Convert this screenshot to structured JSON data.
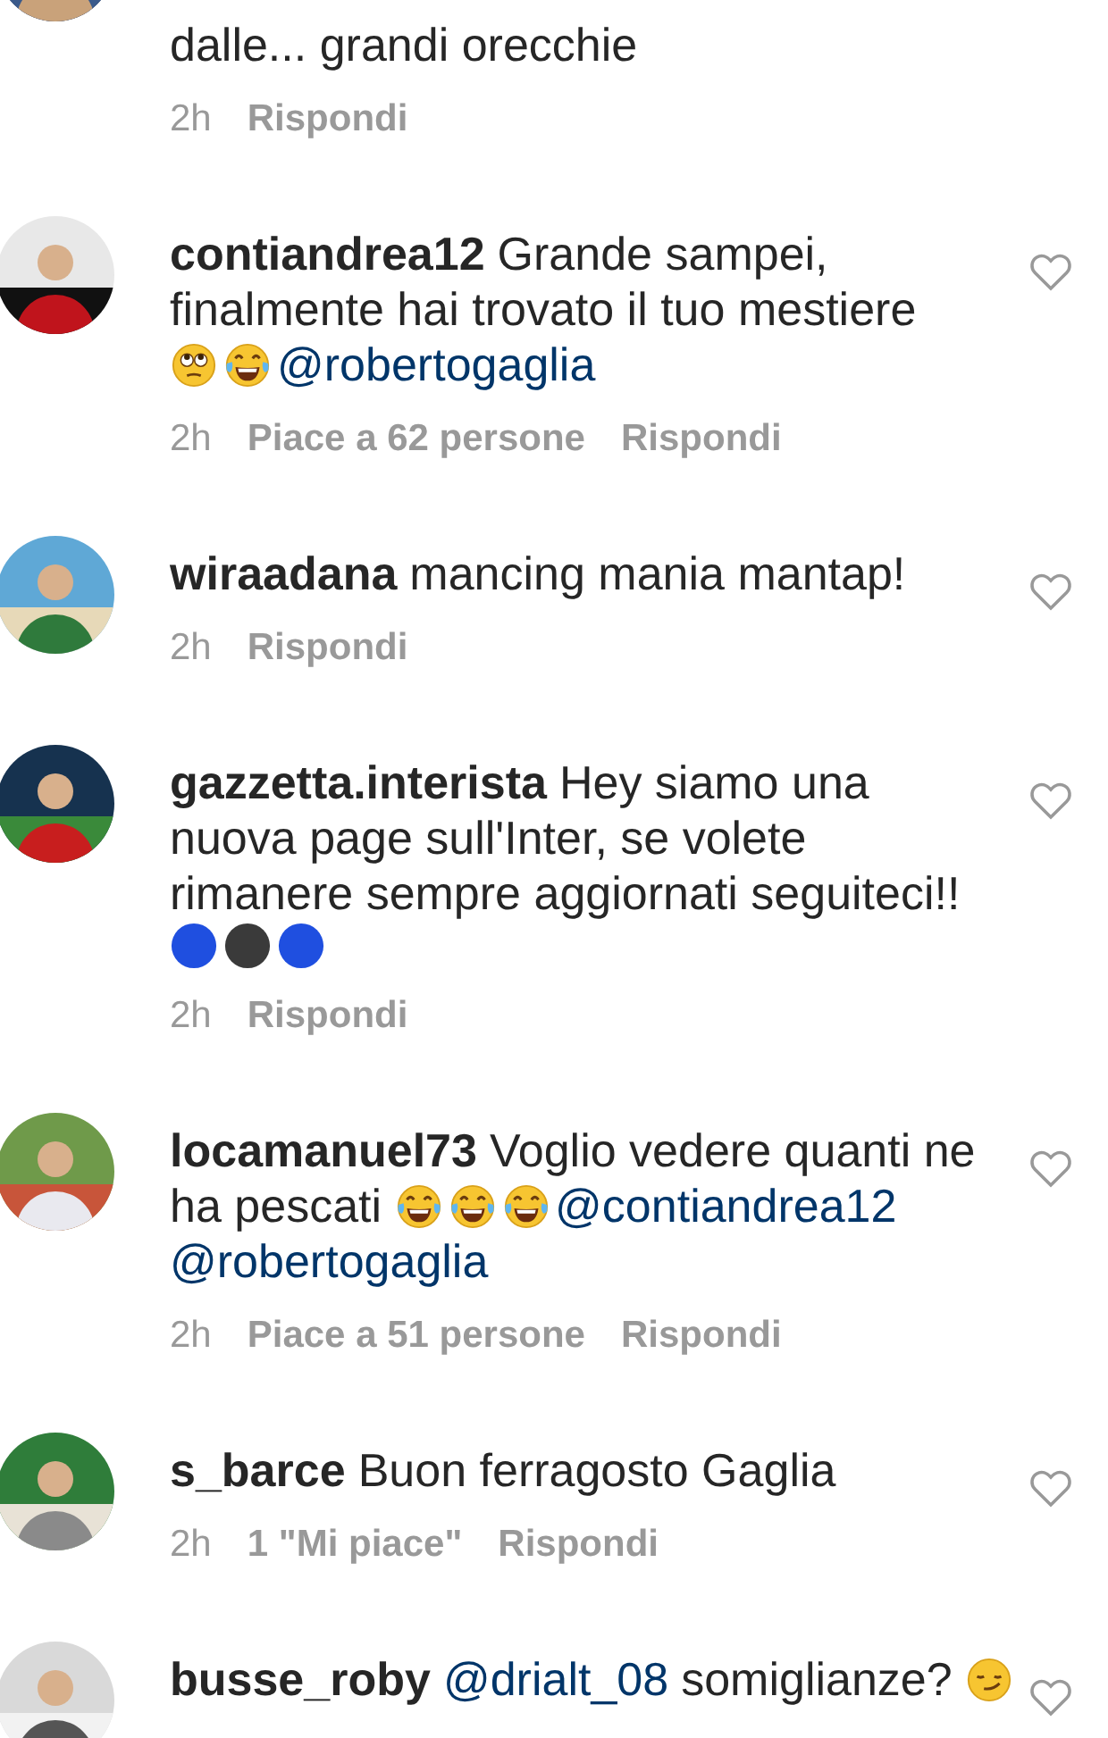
{
  "comments": [
    {
      "lines": [
        [
          {
            "kind": "text",
            "text": "dalle... grandi orecchie"
          }
        ]
      ],
      "time": "2h",
      "reply": "Rispondi"
    },
    {
      "username": "contiandrea12",
      "lines": [
        [
          {
            "kind": "text",
            "text": "Grande sampei,"
          }
        ],
        [
          {
            "kind": "text",
            "text": "finalmente hai trovato il tuo mestiere"
          }
        ],
        [
          {
            "kind": "rolling-eyes"
          },
          {
            "kind": "tears-of-joy"
          },
          {
            "kind": "mention",
            "text": "@robertogaglia"
          }
        ]
      ],
      "liked": false,
      "time": "2h",
      "likes": "Piace a 62 persone",
      "reply": "Rispondi"
    },
    {
      "username": "wiraadana",
      "lines": [
        [
          {
            "kind": "text",
            "text": "mancing mania mantap!"
          }
        ]
      ],
      "liked": false,
      "time": "2h",
      "reply": "Rispondi"
    },
    {
      "username": "gazzetta.interista",
      "lines": [
        [
          {
            "kind": "text",
            "text": "Hey siamo una"
          }
        ],
        [
          {
            "kind": "text",
            "text": "nuova page sull'Inter, se volete"
          }
        ],
        [
          {
            "kind": "text",
            "text": "rimanere sempre aggiornati seguiteci!!"
          }
        ],
        [
          {
            "kind": "ball",
            "color": "#1f4fe0"
          },
          {
            "kind": "ball",
            "color": "#3a3a3a"
          },
          {
            "kind": "ball",
            "color": "#1f4fe0"
          }
        ]
      ],
      "liked": false,
      "time": "2h",
      "reply": "Rispondi"
    },
    {
      "username": "locamanuel73",
      "lines": [
        [
          {
            "kind": "text",
            "text": "Voglio vedere quanti ne"
          }
        ],
        [
          {
            "kind": "text",
            "text": "ha pescati"
          },
          {
            "kind": "tears-of-joy"
          },
          {
            "kind": "tears-of-joy"
          },
          {
            "kind": "tears-of-joy"
          },
          {
            "kind": "mention",
            "text": "@contiandrea12"
          }
        ],
        [
          {
            "kind": "mention",
            "text": "@robertogaglia"
          }
        ]
      ],
      "liked": false,
      "time": "2h",
      "likes": "Piace a 51 persone",
      "reply": "Rispondi"
    },
    {
      "username": "s_barce",
      "lines": [
        [
          {
            "kind": "text",
            "text": "Buon ferragosto Gaglia"
          }
        ]
      ],
      "liked": false,
      "time": "2h",
      "likes": "1 \"Mi piace\"",
      "reply": "Rispondi"
    },
    {
      "username": "busse_roby",
      "lines": [
        [
          {
            "kind": "mention",
            "text": "@drialt_08"
          },
          {
            "kind": "text",
            "text": "somiglianze?"
          },
          {
            "kind": "smirk"
          }
        ]
      ],
      "liked": false
    }
  ]
}
